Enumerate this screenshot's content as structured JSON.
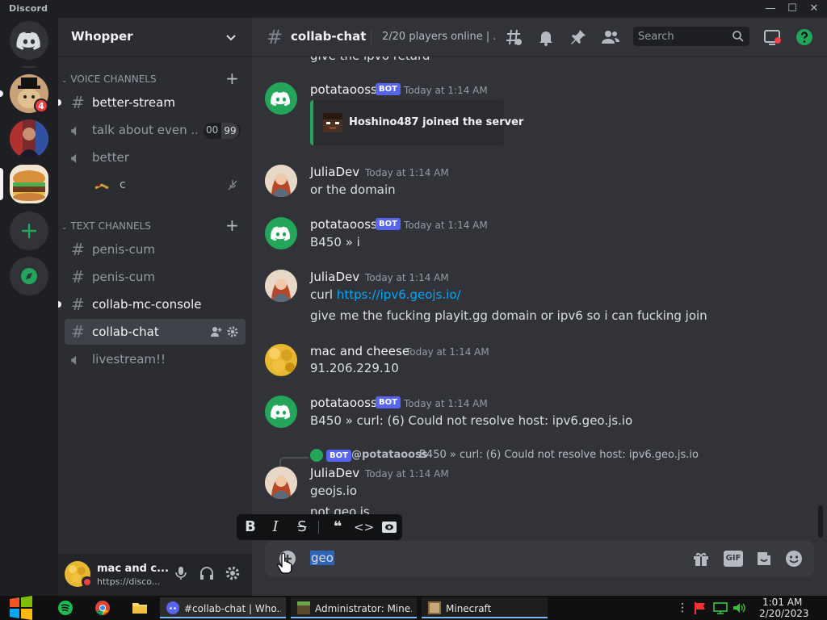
{
  "titlebar": {
    "brand": "Discord",
    "minimize": "—",
    "maximize": "☐",
    "close": "✕"
  },
  "colors": {
    "accent": "#5865f2",
    "green": "#23a55a",
    "red": "#f23f43",
    "link": "#00a8fc",
    "julia": "#f2f3f5"
  },
  "guilds": {
    "unread_badge": "4"
  },
  "server": {
    "name": "Whopper"
  },
  "categories": {
    "voice": "VOICE CHANNELS",
    "text": "TEXT CHANNELS"
  },
  "voice_channels": [
    {
      "label": "better-stream",
      "icon": "hash-icon",
      "unread": true
    },
    {
      "label": "talk about even ...",
      "icon": "speaker-icon",
      "counter_left": "00",
      "counter_right": "99"
    },
    {
      "label": "better",
      "icon": "speaker-icon"
    }
  ],
  "voice_user": {
    "name": "c"
  },
  "text_channels": [
    {
      "label": "penis-cum"
    },
    {
      "label": "penis-cum"
    },
    {
      "label": "collab-mc-console",
      "unread": true
    },
    {
      "label": "collab-chat",
      "active": true
    },
    {
      "label": "livestream!!",
      "icon": "speaker-icon"
    }
  ],
  "user_panel": {
    "name": "mac and c...",
    "status": "https://disco..."
  },
  "chat_header": {
    "channel": "collab-chat",
    "topic": "2/20 players online | ...",
    "search_placeholder": "Search"
  },
  "messages": {
    "partial_top": "give the ipv6 retard",
    "m1": {
      "author": "potataooss",
      "badge": "BOT",
      "time": "Today at 1:14 AM",
      "embed_text": "Hoshino487 joined the server"
    },
    "m2": {
      "author": "JuliaDev",
      "time": "Today at 1:14 AM",
      "text": "or the domain"
    },
    "m3": {
      "author": "potataooss",
      "badge": "BOT",
      "time": "Today at 1:14 AM",
      "text": "B450 » i"
    },
    "m4": {
      "author": "JuliaDev",
      "time": "Today at 1:14 AM",
      "prefix": "curl ",
      "link": "https://ipv6.geojs.io/",
      "text2": "give me the fucking playit.gg domain or ipv6 so i can fucking join"
    },
    "m5": {
      "author": "mac and cheese",
      "time": "Today at 1:14 AM",
      "text": "91.206.229.10"
    },
    "m6": {
      "author": "potataooss",
      "badge": "BOT",
      "time": "Today at 1:14 AM",
      "text": "B450 » curl: (6) Could not resolve host: ipv6.geo.js.io"
    },
    "reply": {
      "badge": "BOT",
      "mention": "@potataooss",
      "text": "B450 » curl: (6) Could not resolve host: ipv6.geo.js.io"
    },
    "m7": {
      "author": "JuliaDev",
      "time": "Today at 1:14 AM",
      "text": "geojs.io",
      "text2": "not geo.js"
    }
  },
  "composer": {
    "value": "geo",
    "gif_label": "GIF"
  },
  "taskbar": {
    "items": [
      "#collab-chat | Who...",
      "Administrator: Mine...",
      "Minecraft"
    ],
    "time": "1:01 AM",
    "date": "2/20/2023"
  }
}
